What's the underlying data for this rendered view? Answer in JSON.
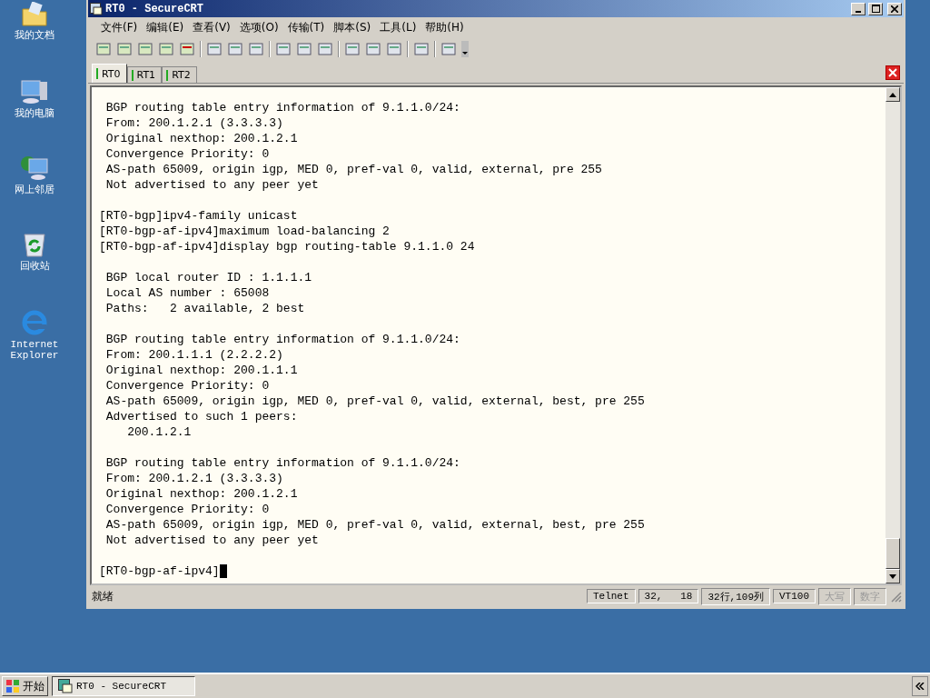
{
  "desktop_icons": [
    {
      "label": "我的文档",
      "kind": "documents"
    },
    {
      "label": "我的电脑",
      "kind": "computer"
    },
    {
      "label": "网上邻居",
      "kind": "network"
    },
    {
      "label": "回收站",
      "kind": "recycle"
    },
    {
      "label": "Internet Explorer",
      "kind": "browser"
    }
  ],
  "window": {
    "title": "RT0 - SecureCRT"
  },
  "menu": [
    "文件(F)",
    "编辑(E)",
    "查看(V)",
    "选项(O)",
    "传输(T)",
    "脚本(S)",
    "工具(L)",
    "帮助(H)"
  ],
  "tabs": [
    {
      "label": "RT0",
      "selected": true
    },
    {
      "label": "RT1",
      "selected": false
    },
    {
      "label": "RT2",
      "selected": false
    }
  ],
  "terminal": {
    "blocks": [
      [
        " BGP routing table entry information of 9.1.1.0/24:",
        " From: 200.1.2.1 (3.3.3.3)",
        " Original nexthop: 200.1.2.1",
        " Convergence Priority: 0",
        " AS-path 65009, origin igp, MED 0, pref-val 0, valid, external, pre 255",
        " Not advertised to any peer yet"
      ],
      [
        "[RT0-bgp]ipv4-family unicast",
        "[RT0-bgp-af-ipv4]maximum load-balancing 2",
        "[RT0-bgp-af-ipv4]display bgp routing-table 9.1.1.0 24"
      ],
      [
        " BGP local router ID : 1.1.1.1",
        " Local AS number : 65008",
        " Paths:   2 available, 2 best"
      ],
      [
        " BGP routing table entry information of 9.1.1.0/24:",
        " From: 200.1.1.1 (2.2.2.2)",
        " Original nexthop: 200.1.1.1",
        " Convergence Priority: 0",
        " AS-path 65009, origin igp, MED 0, pref-val 0, valid, external, best, pre 255",
        " Advertised to such 1 peers:",
        "    200.1.2.1"
      ],
      [
        " BGP routing table entry information of 9.1.1.0/24:",
        " From: 200.1.2.1 (3.3.3.3)",
        " Original nexthop: 200.1.2.1",
        " Convergence Priority: 0",
        " AS-path 65009, origin igp, MED 0, pref-val 0, valid, external, best, pre 255",
        " Not advertised to any peer yet"
      ],
      [
        "[RT0-bgp-af-ipv4]"
      ]
    ]
  },
  "status_bar": {
    "message": "就绪",
    "cells": [
      {
        "text": "Telnet",
        "disabled": false
      },
      {
        "text": "32,   18",
        "disabled": false
      },
      {
        "text": "32行,109列",
        "disabled": false
      },
      {
        "text": "VT100",
        "disabled": false
      },
      {
        "text": "大写",
        "disabled": true
      },
      {
        "text": "数字",
        "disabled": true
      }
    ]
  },
  "taskbar": {
    "start": "开始",
    "tasks": [
      "RT0 - SecureCRT"
    ]
  }
}
